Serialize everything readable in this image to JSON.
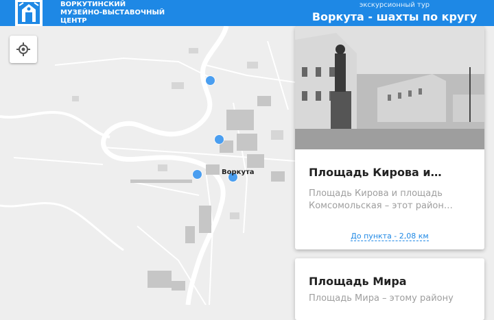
{
  "header": {
    "org_line1": "ВОРКУТИНСКИЙ",
    "org_line2": "МУЗЕЙНО-ВЫСТАВОЧНЫЙ",
    "org_line3": "ЦЕНТР",
    "tour_type": "экскурсионный тур",
    "tour_title": "Воркута - шахты по кругу"
  },
  "map": {
    "city_label": "Воркута",
    "marker_color": "#4a9ef0",
    "locate_icon": "crosshair-icon"
  },
  "cards": [
    {
      "title": "Площадь Кирова и…",
      "description": "Площадь Кирова и площадь Комсомольская – этот район…",
      "distance": "До пункта - 2,08 км"
    },
    {
      "title": "Площадь Мира",
      "description": "Площадь Мира – этому району"
    }
  ],
  "colors": {
    "header_bg": "#1e88e5",
    "link": "#1e88e5",
    "map_bg": "#eeeeee"
  }
}
